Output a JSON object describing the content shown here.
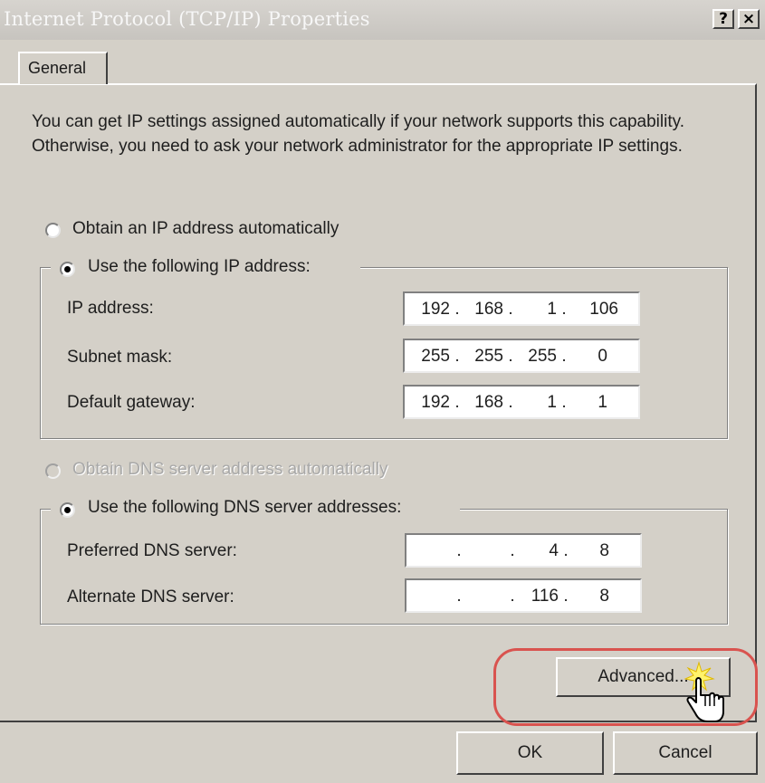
{
  "window": {
    "title": "Internet Protocol (TCP/IP) Properties",
    "help_label": "?",
    "close_label": "×"
  },
  "tabs": [
    {
      "label": "General",
      "selected": true
    }
  ],
  "intro_text": "You can get IP settings assigned automatically if your network supports this capability. Otherwise, you need to ask your network administrator for the appropriate IP settings.",
  "ip": {
    "auto_label": "Obtain an IP address automatically",
    "auto_selected": false,
    "manual_label": "Use the following IP address:",
    "manual_selected": true,
    "fields": [
      {
        "label": "IP address:",
        "octets": [
          "192",
          "168",
          "1",
          "106"
        ]
      },
      {
        "label": "Subnet mask:",
        "octets": [
          "255",
          "255",
          "255",
          "0"
        ]
      },
      {
        "label": "Default gateway:",
        "octets": [
          "192",
          "168",
          "1",
          "1"
        ]
      }
    ]
  },
  "dns": {
    "auto_label": "Obtain DNS server address automatically",
    "auto_enabled": false,
    "manual_label": "Use the following DNS server addresses:",
    "manual_selected": true,
    "fields": [
      {
        "label": "Preferred DNS server:",
        "octets": [
          "",
          "",
          "4",
          "8"
        ]
      },
      {
        "label": "Alternate DNS server:",
        "octets": [
          "",
          "",
          "116",
          "8"
        ]
      }
    ]
  },
  "buttons": {
    "advanced": "Advanced...",
    "ok": "OK",
    "cancel": "Cancel"
  },
  "icons": {
    "cursor": "hand-pointer-icon",
    "sparkle": "click-sparkle-icon"
  },
  "colors": {
    "highlight": "#d9534f",
    "dialog_bg": "#d4d0c8"
  }
}
